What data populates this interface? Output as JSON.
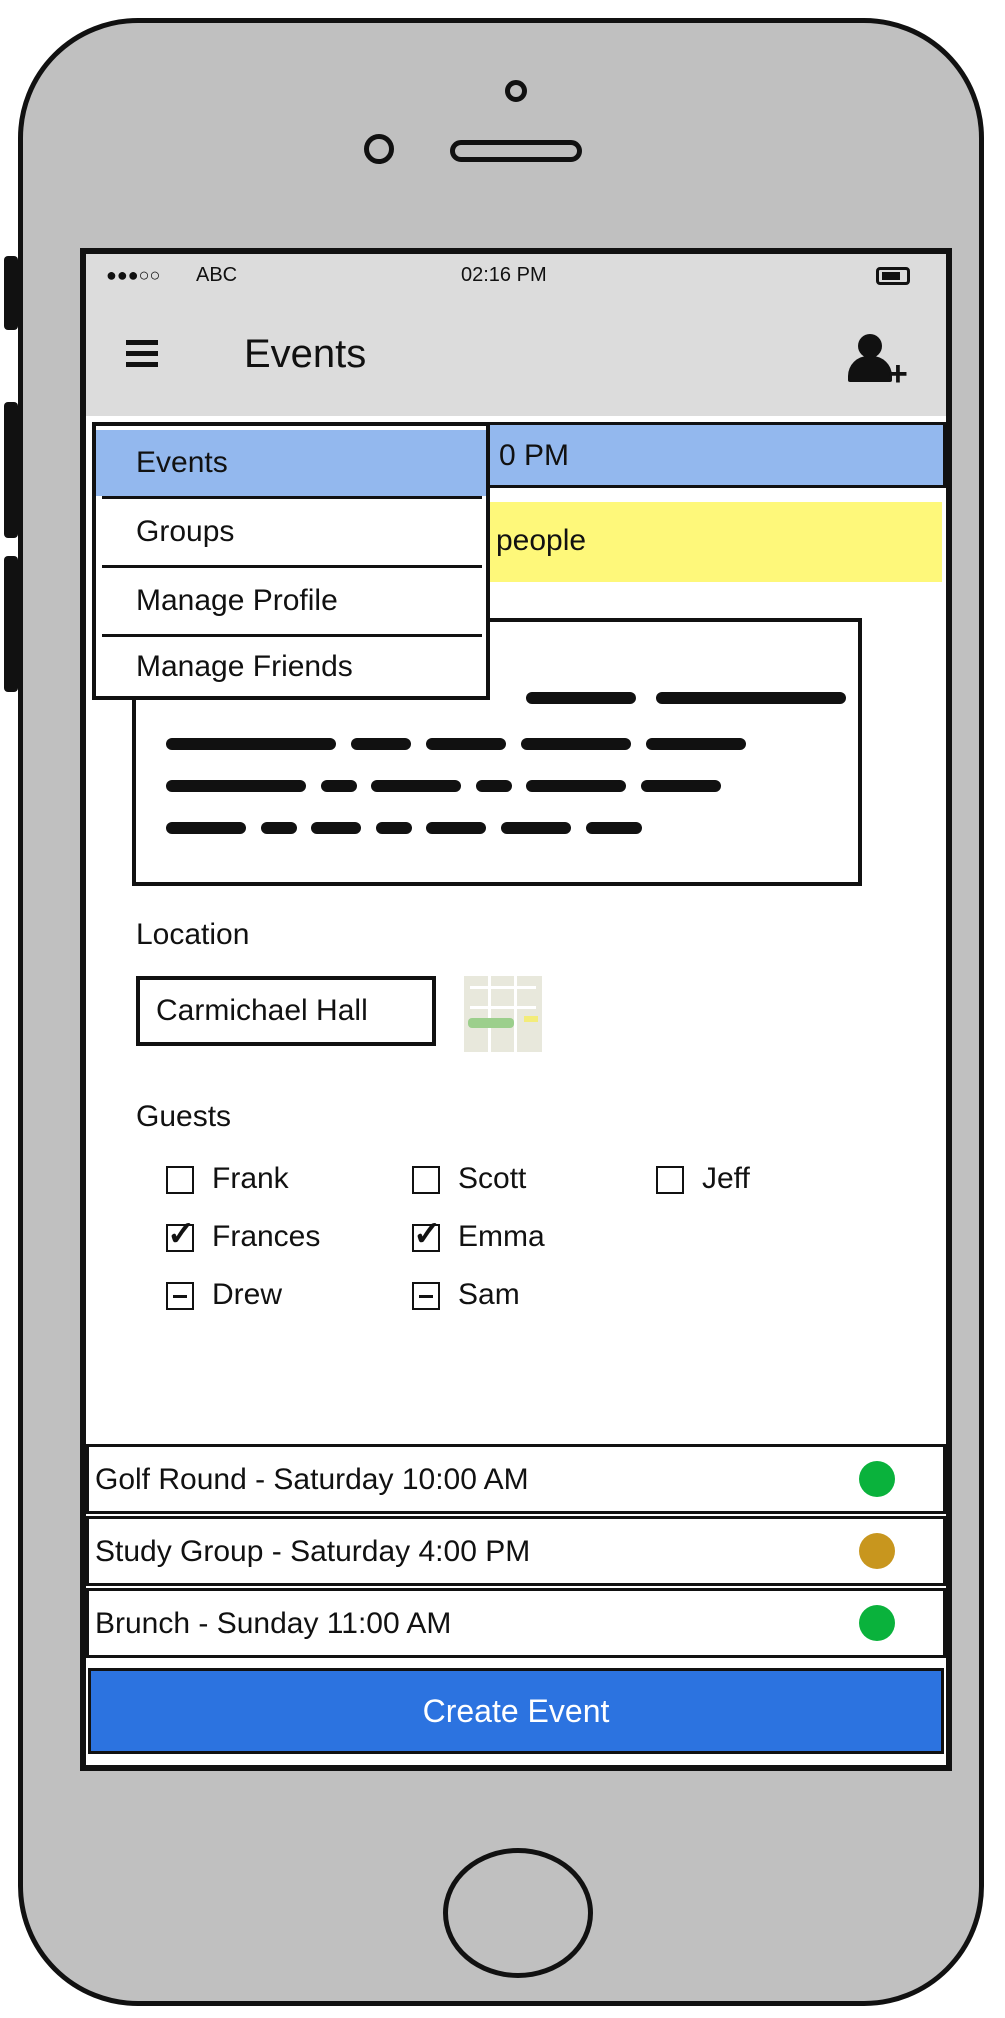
{
  "status_bar": {
    "carrier": "ABC",
    "time": "02:16 PM"
  },
  "nav": {
    "title": "Events"
  },
  "menu": {
    "items": [
      {
        "label": "Events",
        "selected": true
      },
      {
        "label": "Groups"
      },
      {
        "label": "Manage Profile"
      },
      {
        "label": "Manage Friends"
      }
    ]
  },
  "event_detail": {
    "time_fragment": "0 PM",
    "people_fragment": "people",
    "location_label": "Location",
    "location_value": "Carmichael Hall",
    "guests_label": "Guests",
    "guests": [
      {
        "name": "Frank",
        "state": "unchecked"
      },
      {
        "name": "Scott",
        "state": "unchecked"
      },
      {
        "name": "Jeff",
        "state": "unchecked"
      },
      {
        "name": "Frances",
        "state": "checked"
      },
      {
        "name": "Emma",
        "state": "checked"
      },
      {
        "name": "Drew",
        "state": "indeterminate"
      },
      {
        "name": "Sam",
        "state": "indeterminate"
      }
    ]
  },
  "event_list": [
    {
      "label": "Golf Round - Saturday 10:00 AM",
      "status_color": "#0ab23c"
    },
    {
      "label": "Study Group - Saturday 4:00 PM",
      "status_color": "#c8961e"
    },
    {
      "label": "Brunch - Sunday 11:00 AM",
      "status_color": "#0ab23c"
    }
  ],
  "create_button": {
    "label": "Create Event",
    "color": "#2c73e0"
  },
  "colors": {
    "highlight_blue": "#93b8ee",
    "highlight_yellow": "#fef87a",
    "chrome_gray": "#dcdcdc",
    "phone_gray": "#c0c0c0"
  }
}
